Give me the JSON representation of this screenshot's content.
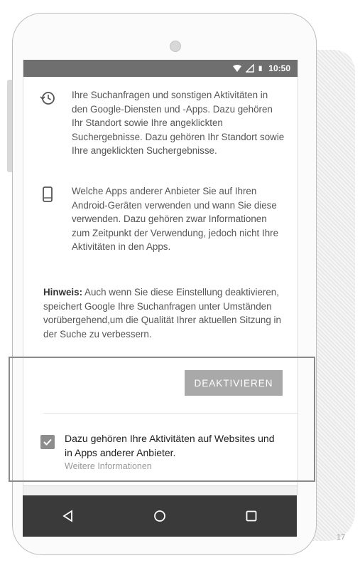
{
  "status_bar": {
    "time": "10:50"
  },
  "items": [
    {
      "icon": "history-icon",
      "text": "Ihre Suchanfragen und sonstigen Aktivitäten in den Google-Diensten und -Apps. Dazu gehören Ihr Standort sowie Ihre angeklickten Suchergebnisse. Dazu gehören Ihr Standort sowie Ihre angeklickten Suchergebnisse."
    },
    {
      "icon": "phone-icon",
      "text": "Welche Apps anderer Anbieter Sie auf Ihren Android-Geräten verwenden und wann Sie diese verwenden. Dazu gehören zwar Informationen zum Zeitpunkt der Verwendung, jedoch nicht Ihre Aktivitäten in den Apps."
    }
  ],
  "note": {
    "label": "Hinweis:",
    "text": " Auch wenn Sie diese Einstellung deaktivieren, speichert Google Ihre Suchanfragen unter Umständen vorübergehend,um die Qualität Ihrer aktuellen Sitzung in der Suche zu verbessern."
  },
  "deactivate_button": "DEAKTIVIEREN",
  "checkbox": {
    "checked": true,
    "label": "Dazu gehören Ihre Aktivitäten auf Websites und in Apps anderer Anbieter.",
    "more_link": "Weitere Informationen"
  },
  "navbar": {
    "back": "back-icon",
    "home": "home-icon",
    "recents": "recents-icon"
  },
  "page_number": "17",
  "colors": {
    "status_bar": "#6f6f6f",
    "button": "#a9a9a9",
    "navbar": "#3a3a3a",
    "checkbox": "#8d8d8d"
  }
}
